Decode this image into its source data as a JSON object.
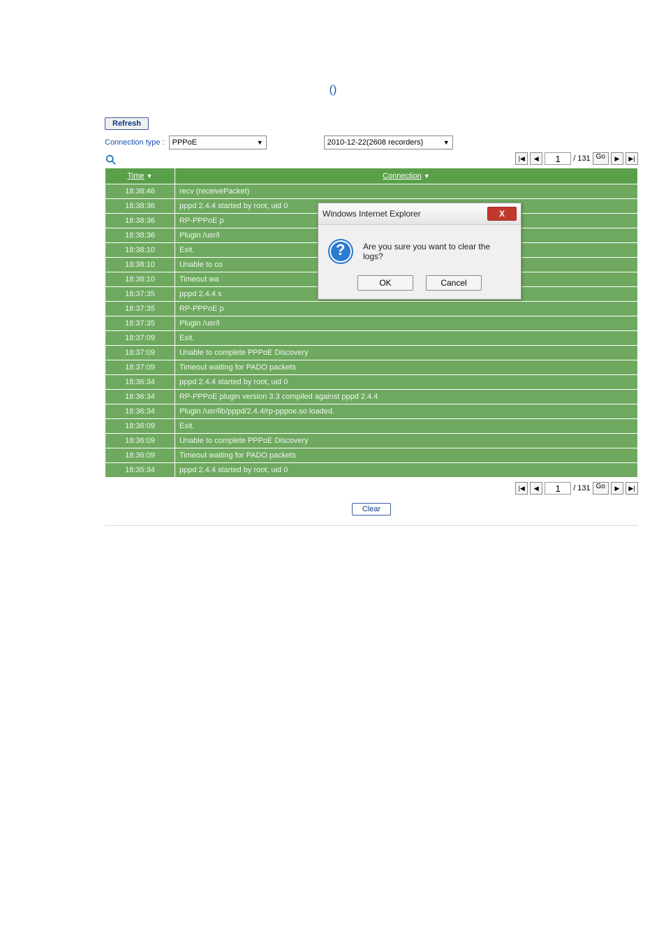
{
  "parenthesis": {
    "left": "(",
    "right": ")"
  },
  "buttons": {
    "refresh": "Refresh",
    "clear": "Clear",
    "go": "Go"
  },
  "filter": {
    "label": "Connection type :",
    "type": "PPPoE",
    "datefile": "2010-12-22(2608 recorders)"
  },
  "pager": {
    "page": "1",
    "total": "131",
    "sep": "/"
  },
  "headers": {
    "time": "Time",
    "conn": "Connection"
  },
  "rows": [
    {
      "t": "18:38:46",
      "c": "recv (receivePacket)"
    },
    {
      "t": "18:38:36",
      "c": "pppd 2.4.4 started by root, uid 0"
    },
    {
      "t": "18:38:36",
      "c": "RP-PPPoE p"
    },
    {
      "t": "18:38:36",
      "c": "Plugin /usr/l"
    },
    {
      "t": "18:38:10",
      "c": "Exit."
    },
    {
      "t": "18:38:10",
      "c": "Unable to co"
    },
    {
      "t": "18:38:10",
      "c": "Timeout wa"
    },
    {
      "t": "18:37:35",
      "c": "pppd 2.4.4 s"
    },
    {
      "t": "18:37:35",
      "c": "RP-PPPoE p"
    },
    {
      "t": "18:37:35",
      "c": "Plugin /usr/l"
    },
    {
      "t": "18:37:09",
      "c": "Exit."
    },
    {
      "t": "18:37:09",
      "c": "Unable to complete PPPoE Discovery"
    },
    {
      "t": "18:37:09",
      "c": "Timeout waiting for PADO packets"
    },
    {
      "t": "18:36:34",
      "c": "pppd 2.4.4 started by root, uid 0"
    },
    {
      "t": "18:36:34",
      "c": "RP-PPPoE plugin version 3.3 compiled against pppd 2.4.4"
    },
    {
      "t": "18:36:34",
      "c": "Plugin /usr/lib/pppd/2.4.4/rp-pppoe.so loaded."
    },
    {
      "t": "18:36:09",
      "c": "Exit."
    },
    {
      "t": "18:36:09",
      "c": "Unable to complete PPPoE Discovery"
    },
    {
      "t": "18:36:09",
      "c": "Timeout waiting for PADO packets"
    },
    {
      "t": "18:35:34",
      "c": "pppd 2.4.4 started by root, uid 0"
    }
  ],
  "dialog": {
    "title": "Windows Internet Explorer",
    "msg": "Are you sure you want to clear the logs?",
    "ok": "OK",
    "cancel": "Cancel",
    "close": "X"
  }
}
